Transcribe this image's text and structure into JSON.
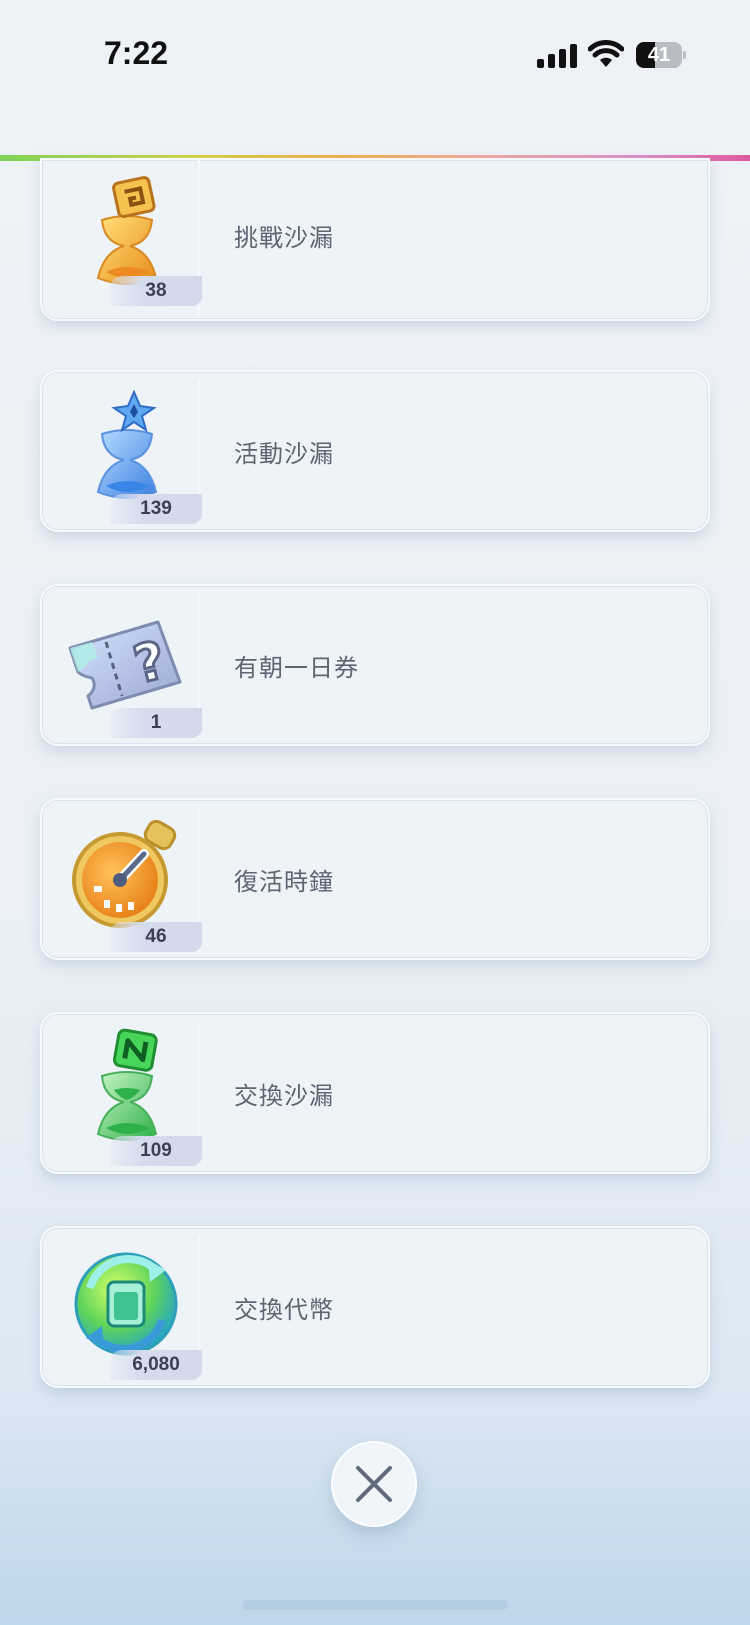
{
  "status_bar": {
    "time": "7:22",
    "battery_level": "41",
    "signal_icon": "cellular-signal-icon",
    "wifi_icon": "wifi-icon"
  },
  "colors": {
    "card_bg": "#eef3f8",
    "label_text": "#5d6472",
    "count_text": "#3b4152"
  },
  "items": [
    {
      "name": "挑戰沙漏",
      "count": "38",
      "icon": "gold-hourglass-icon"
    },
    {
      "name": "活動沙漏",
      "count": "139",
      "icon": "blue-hourglass-icon"
    },
    {
      "name": "有朝一日券",
      "count": "1",
      "icon": "mystery-ticket-icon"
    },
    {
      "name": "復活時鐘",
      "count": "46",
      "icon": "stopwatch-icon"
    },
    {
      "name": "交換沙漏",
      "count": "109",
      "icon": "green-hourglass-icon"
    },
    {
      "name": "交換代幣",
      "count": "6,080",
      "icon": "exchange-token-icon"
    }
  ],
  "close_button": {
    "icon": "close-icon"
  }
}
